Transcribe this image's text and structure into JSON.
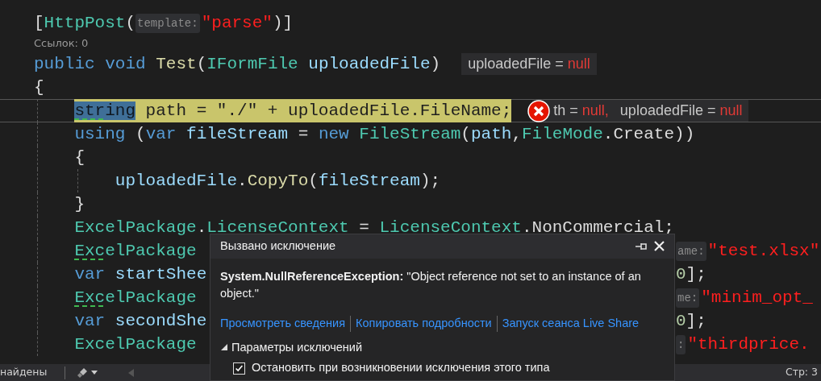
{
  "editor": {
    "lines": [
      {
        "kind": "code",
        "current": false,
        "dotted": false,
        "tokens": [
          {
            "text": "[",
            "kind": "punct"
          },
          {
            "text": "HttpPost",
            "kind": "type"
          },
          {
            "text": "(",
            "kind": "punct"
          },
          {
            "text": "template:",
            "kind": "hint"
          },
          {
            "text": "\"parse\"",
            "kind": "str"
          },
          {
            "text": ")]",
            "kind": "punct"
          }
        ]
      },
      {
        "kind": "codelens",
        "current": false,
        "dotted": false,
        "tokens": [
          {
            "text": "Ссылок: 0"
          }
        ]
      },
      {
        "kind": "code",
        "current": false,
        "dotted": false,
        "tokens": [
          {
            "text": "public ",
            "kind": "kw"
          },
          {
            "text": "void ",
            "kind": "kw"
          },
          {
            "text": "Test",
            "kind": "method"
          },
          {
            "text": "(",
            "kind": "punct"
          },
          {
            "text": "IFormFile ",
            "kind": "type"
          },
          {
            "text": "uploadedFile",
            "kind": "ident"
          },
          {
            "text": ")",
            "kind": "punct"
          }
        ],
        "datatips": {
          "error": false,
          "items": [
            {
              "label": "uploadedFile =",
              "value": "null"
            }
          ]
        }
      },
      {
        "kind": "code",
        "current": false,
        "dotted": false,
        "tokens": [
          {
            "text": "{",
            "kind": "punct"
          }
        ],
        "children": [
          {
            "kind": "code",
            "current": true,
            "dotted": true,
            "tokens": [
              {
                "text": "string",
                "kind": "selected"
              },
              {
                "text": " path = \"./\" + uploadedFile.FileName;",
                "kind": "plain"
              }
            ],
            "datatips": {
              "error": true,
              "items": [
                {
                  "label": "th =",
                  "value": "null,"
                },
                {
                  "label": "uploadedFile =",
                  "value": "null"
                }
              ]
            }
          },
          {
            "kind": "code",
            "current": false,
            "dotted": false,
            "tokens": [
              {
                "text": "using",
                "kind": "kw"
              },
              {
                "text": " (",
                "kind": "punct"
              },
              {
                "text": "var ",
                "kind": "kw"
              },
              {
                "text": "fileStream",
                "kind": "ident"
              },
              {
                "text": " = ",
                "kind": "punct"
              },
              {
                "text": "new ",
                "kind": "kw"
              },
              {
                "text": "FileStream",
                "kind": "type"
              },
              {
                "text": "(",
                "kind": "punct"
              },
              {
                "text": "path",
                "kind": "ident"
              },
              {
                "text": ",",
                "kind": "punct"
              },
              {
                "text": "FileMode",
                "kind": "type"
              },
              {
                "text": ".Create))",
                "kind": "punct"
              }
            ]
          },
          {
            "kind": "code",
            "current": false,
            "dotted": false,
            "tokens": [
              {
                "text": "{",
                "kind": "punct"
              }
            ],
            "children": [
              {
                "kind": "code",
                "current": false,
                "dotted": false,
                "tokens": [
                  {
                    "text": "uploadedFile",
                    "kind": "ident"
                  },
                  {
                    "text": ".",
                    "kind": "punct"
                  },
                  {
                    "text": "CopyTo",
                    "kind": "method"
                  },
                  {
                    "text": "(",
                    "kind": "punct"
                  },
                  {
                    "text": "fileStream",
                    "kind": "ident"
                  },
                  {
                    "text": ");",
                    "kind": "punct"
                  }
                ]
              }
            ]
          },
          {
            "kind": "code",
            "current": false,
            "dotted": false,
            "tokens": [
              {
                "text": "}",
                "kind": "punct"
              }
            ]
          },
          {
            "kind": "code",
            "current": false,
            "dotted": false,
            "tokens": [
              {
                "text": "ExcelPackage",
                "kind": "type"
              },
              {
                "text": ".",
                "kind": "punct"
              },
              {
                "text": "LicenseContext",
                "kind": "type"
              },
              {
                "text": " = ",
                "kind": "punct"
              },
              {
                "text": "LicenseContext",
                "kind": "type"
              },
              {
                "text": ".NonCommercial;",
                "kind": "punct"
              }
            ]
          },
          {
            "kind": "code",
            "current": false,
            "dotted": true,
            "tokens": [
              {
                "text": "ExcelPackage",
                "kind": "type"
              }
            ],
            "right": [
              {
                "text": "ame:",
                "kind": "hint"
              },
              {
                "text": "\"test.xlsx\"",
                "kind": "str"
              }
            ]
          },
          {
            "kind": "code",
            "current": false,
            "dotted": false,
            "tokens": [
              {
                "text": "var ",
                "kind": "kw"
              },
              {
                "text": "startShee",
                "kind": "ident"
              }
            ],
            "right": [
              {
                "text": "0",
                "kind": "num"
              },
              {
                "text": "];",
                "kind": "punct"
              }
            ]
          },
          {
            "kind": "code",
            "current": false,
            "dotted": true,
            "tokens": [
              {
                "text": "ExcelPackage",
                "kind": "type"
              }
            ],
            "right": [
              {
                "text": "me:",
                "kind": "hint"
              },
              {
                "text": "\"minim_opt_",
                "kind": "str"
              }
            ]
          },
          {
            "kind": "code",
            "current": false,
            "dotted": false,
            "tokens": [
              {
                "text": "var ",
                "kind": "kw"
              },
              {
                "text": "secondShe",
                "kind": "ident"
              }
            ],
            "right": [
              {
                "text": "0",
                "kind": "num"
              },
              {
                "text": "];",
                "kind": "punct"
              }
            ]
          },
          {
            "kind": "code",
            "current": false,
            "dotted": false,
            "tokens": [
              {
                "text": "ExcelPackage",
                "kind": "type"
              }
            ],
            "right": [
              {
                "text": ":",
                "kind": "hint"
              },
              {
                "text": "\"thirdprice.",
                "kind": "str"
              }
            ]
          }
        ]
      }
    ]
  },
  "exception_popup": {
    "title": "Вызвано исключение",
    "message": "**System.NullReferenceException:** \"Object reference not set to an instance of an object.\"",
    "links": [
      "Просмотреть сведения",
      "Копировать подробности",
      "Запуск сеанса Live Share"
    ],
    "options": {
      "title": "Параметры исключений",
      "expanded": true,
      "items": [
        {
          "label": "Остановить при возникновении исключения этого типа",
          "checked": true
        }
      ]
    }
  },
  "status_bar": {
    "left_text": "найдены",
    "right_text": "Стр: 3"
  }
}
